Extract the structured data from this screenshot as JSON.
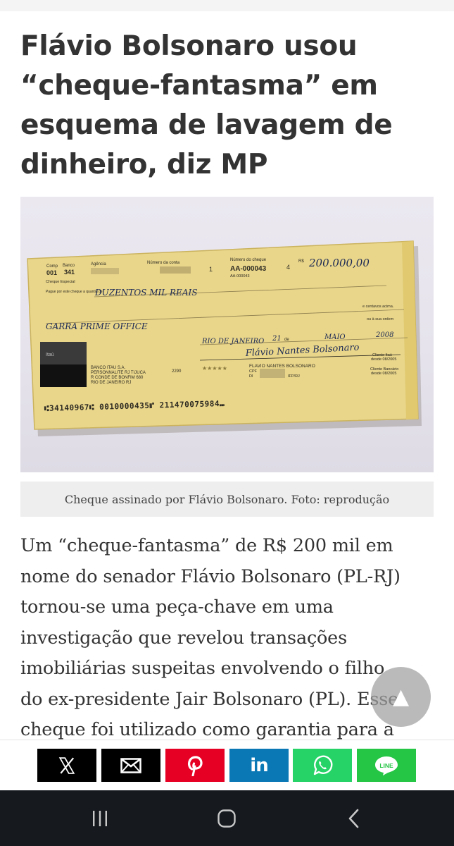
{
  "article": {
    "headline_lines": [
      "Flávio Bolsonaro usou",
      "“cheque-fantasma” em",
      "esquema de lavagem de",
      "dinheiro, diz MP"
    ],
    "photo_caption": "Cheque assinado por Flávio Bolsonaro. Foto: reprodução",
    "body_lines": [
      "Um “cheque-fantasma” de R$ 200 mil em",
      "nome do senador Flávio Bolsonaro (PL-RJ)",
      "tornou-se uma peça-chave em uma",
      "investigação que revelou transações",
      "imobiliárias suspeitas envolvendo o filho",
      "do ex-presidente Jair Bolsonaro (PL). Esse",
      "cheque foi utilizado como garantia para a"
    ]
  },
  "cheque": {
    "field_comp": "Comp",
    "field_banco": "Banco",
    "field_agencia": "Agência",
    "field_conta": "Número da conta",
    "field_numero": "Número do cheque",
    "comp": "001",
    "banco": "341",
    "cheque_number": "AA-000043",
    "cheque_number_small": "AA-000043",
    "digit_a": "1",
    "digit_b": "4",
    "currency": "R$",
    "amount": "200.000,00",
    "cheque_especial": "Cheque Especial",
    "pague_label": "Pague por este cheque a quantia de",
    "amount_words": "DUZENTOS MIL REAIS",
    "centavos_label": "e centavos acima.",
    "a_ordem_label": "a ou à sua ordem",
    "payee": "GARRA PRIME OFFICE",
    "ou_label": "ou à sua ordem",
    "place_date_city": "RIO DE JANEIRO",
    "place_date_day": "21",
    "place_date_de": "de",
    "place_date_month": "MAIO",
    "place_date_year": "2008",
    "signature": "Flávio Nantes Bolsonaro",
    "holder_name": "FLAVIO NANTES BOLSONARO",
    "holder_cpf_label": "CPF",
    "holder_di_label": "DI",
    "holder_di_suffix": "IFP/RJ",
    "bank_logo_text": "Itaú",
    "bank_name": "BANCO ITAU S.A.",
    "bank_branch": "PERSONNALITE RJ TIJUCA",
    "bank_branch_code": "2290",
    "bank_address": "R CONDE DE BONFIM 680",
    "bank_city": "RIO DE JANEIRO RJ",
    "stars": "★★★★★",
    "client_label_1": "Cliente Itaú",
    "client_since_1": "desde 08/2005",
    "client_label_2": "Cliente Bancário",
    "client_since_2": "desde 08/2005",
    "micr_line": "⑆34140967⑆ 0010000435⑈ 211470075984⑉"
  },
  "share": {
    "items": [
      {
        "name": "x",
        "icon": "x-logo-icon"
      },
      {
        "name": "email",
        "icon": "envelope-icon"
      },
      {
        "name": "pinterest",
        "icon": "pinterest-icon"
      },
      {
        "name": "linkedin",
        "label": "in",
        "icon": "linkedin-icon"
      },
      {
        "name": "whatsapp",
        "icon": "whatsapp-icon"
      },
      {
        "name": "line",
        "label": "LINE",
        "icon": "line-icon"
      }
    ],
    "colors": {
      "x": "#000000",
      "email": "#000000",
      "pinterest": "#e60023",
      "linkedin": "#0a78b5",
      "whatsapp": "#25d366",
      "line": "#25c545"
    }
  },
  "scroll_top": {
    "icon": "up-triangle-icon",
    "glyph": "▲"
  },
  "nav": {
    "recent": "recent-apps-icon",
    "home": "home-icon",
    "back": "back-icon"
  }
}
